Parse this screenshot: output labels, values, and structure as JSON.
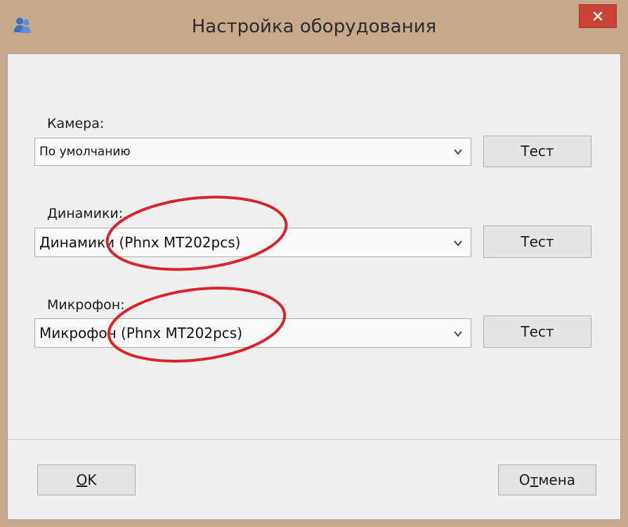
{
  "window": {
    "title": "Настройка оборудования",
    "app_icon": "users-icon",
    "close_icon": "close-icon"
  },
  "camera": {
    "label": "Камера:",
    "value": "По умолчанию",
    "test_label": "Тест"
  },
  "speakers": {
    "label": "Динамики:",
    "value": "Динамики (Phnx MT202pcs)",
    "test_label": "Тест"
  },
  "microphone": {
    "label": "Микрофон:",
    "value": "Микрофон (Phnx MT202pcs)",
    "test_label": "Тест"
  },
  "footer": {
    "ok_accel": "O",
    "ok_rest": "K",
    "cancel_pre": "О",
    "cancel_accel": "т",
    "cancel_rest": "мена"
  },
  "colors": {
    "title_bar": "#c8a98c",
    "close_button": "#c94437",
    "annotation": "#d9242b"
  }
}
